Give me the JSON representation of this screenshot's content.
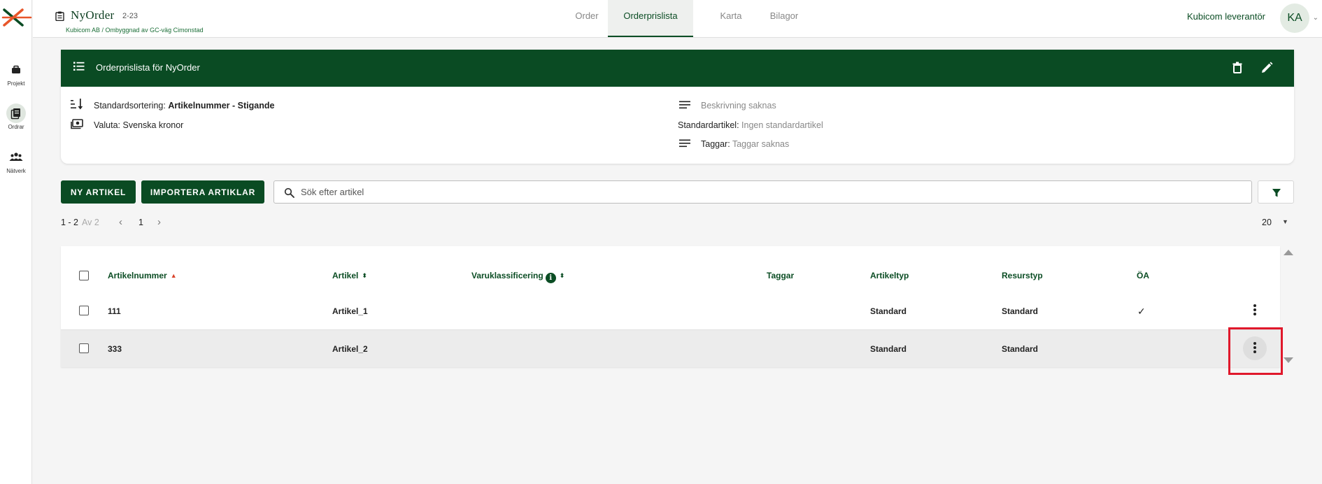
{
  "colors": {
    "brand_green": "#0a4b23",
    "accent_orange": "#e8562a",
    "highlight": "#e0182b"
  },
  "rail": {
    "items": [
      {
        "label": "Projekt",
        "icon": "briefcase-icon"
      },
      {
        "label": "Ordrar",
        "icon": "orders-icon"
      },
      {
        "label": "Nätverk",
        "icon": "network-icon"
      }
    ]
  },
  "header": {
    "title": "NyOrder",
    "number": "2-23",
    "breadcrumb": "Kubicom AB / Ombyggnad av GC-väg Cimonstad",
    "tabs": [
      {
        "label": "Order"
      },
      {
        "label": "Orderprislista"
      },
      {
        "label": "Karta"
      },
      {
        "label": "Bilagor"
      }
    ],
    "active_tab": "Orderprislista",
    "user_name": "Kubicom leverantör",
    "avatar_initials": "KA"
  },
  "pricelist": {
    "title": "Orderprislista för NyOrder",
    "sort_label": "Standardsortering:",
    "sort_value": "Artikelnummer - Stigande",
    "currency_label": "Valuta:",
    "currency_value": "Svenska kronor",
    "description": "Beskrivning saknas",
    "std_article_label": "Standardartikel:",
    "std_article_value": "Ingen standardartikel",
    "tags_label": "Taggar:",
    "tags_value": "Taggar saknas"
  },
  "actions": {
    "new_article": "NY ARTIKEL",
    "import_articles": "IMPORTERA ARTIKLAR",
    "search_placeholder": "Sök efter artikel"
  },
  "pagination": {
    "range": "1 - 2",
    "of": "Av 2",
    "page": "1",
    "per_page": "20"
  },
  "table": {
    "columns": {
      "artikelnummer": "Artikelnummer",
      "artikel": "Artikel",
      "varuklassificering": "Varuklassificering",
      "taggar": "Taggar",
      "artikeltyp": "Artikeltyp",
      "resurstyp": "Resurstyp",
      "oa": "ÖA"
    },
    "rows": [
      {
        "artikelnummer": "111",
        "artikel": "Artikel_1",
        "artikeltyp": "Standard",
        "resurstyp": "Standard",
        "oa": "✓"
      },
      {
        "artikelnummer": "333",
        "artikel": "Artikel_2",
        "artikeltyp": "Standard",
        "resurstyp": "Standard",
        "oa": ""
      }
    ]
  }
}
